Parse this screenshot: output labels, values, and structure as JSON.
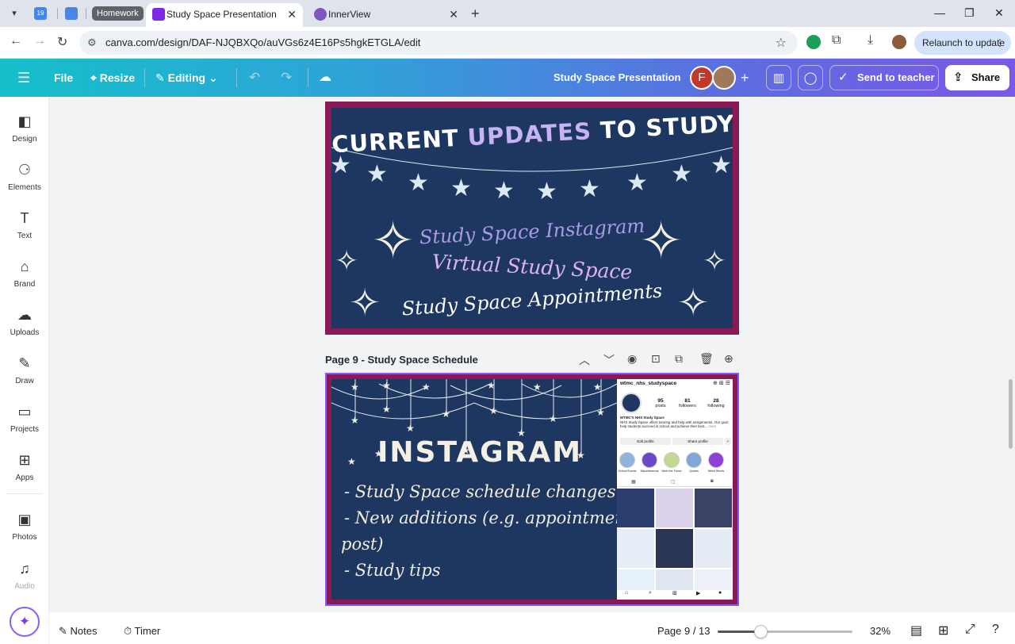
{
  "browser": {
    "tabs": [
      {
        "label": "Homework",
        "kind": "group"
      },
      {
        "label": "Study Space Presentation - Pres",
        "active": true
      },
      {
        "label": "InnerView",
        "active": false
      }
    ],
    "calendar_badge": "19",
    "url": "canva.com/design/DAF-NJQBXQo/auVGs6z4E16Ps5hgkETGLA/edit",
    "relaunch_label": "Relaunch to update"
  },
  "canva_header": {
    "file_label": "File",
    "resize_label": "Resize",
    "editing_label": "Editing",
    "presentation_name": "Study Space Presentation",
    "avatar_initial": "F",
    "send_label": "Send to teacher",
    "share_label": "Share"
  },
  "sidebar": {
    "items": [
      {
        "label": "Design",
        "icon": "design-icon",
        "glyph": "◧"
      },
      {
        "label": "Elements",
        "icon": "elements-icon",
        "glyph": "⚆"
      },
      {
        "label": "Text",
        "icon": "text-icon",
        "glyph": "T"
      },
      {
        "label": "Brand",
        "icon": "brand-icon",
        "glyph": "⌂"
      },
      {
        "label": "Uploads",
        "icon": "uploads-icon",
        "glyph": "☁"
      },
      {
        "label": "Draw",
        "icon": "draw-icon",
        "glyph": "✎"
      },
      {
        "label": "Projects",
        "icon": "projects-icon",
        "glyph": "▭"
      },
      {
        "label": "Apps",
        "icon": "apps-icon",
        "glyph": "⊞"
      },
      {
        "label": "Photos",
        "icon": "photos-icon",
        "glyph": "▣"
      },
      {
        "label": "Audio",
        "icon": "audio-icon",
        "glyph": "♫"
      }
    ]
  },
  "slide8": {
    "title_a": "CURRENT ",
    "title_b": "UPDATES",
    "title_c": " TO STUDY SPACE",
    "line1": "Study Space Instagram",
    "line2": "Virtual Study Space",
    "line3": "Study Space Appointments"
  },
  "page9": {
    "page_title": "Page 9 - Study Space Schedule",
    "heading": "INSTAGRAM",
    "bullets": [
      "-  Study Space schedule changes",
      "-  New additions (e.g. appointments",
      "post)",
      "-  Study tips"
    ]
  },
  "instagram": {
    "username": "wtmc_nhs_studyspace",
    "stats": [
      {
        "value": "95",
        "label": "posts"
      },
      {
        "value": "81",
        "label": "followers"
      },
      {
        "value": "28",
        "label": "following"
      }
    ],
    "bio_name": "WTMC'S NHS Study Space",
    "bio_text": "NHS Study Space offers tutoring and help with assignments. Our goal: help students succeed in school and achieve their best...",
    "bio_more": "more",
    "edit_profile": "Edit profile",
    "share_profile": "Share profile",
    "highlights": [
      "School Events",
      "Miscellaneous",
      "Meet the Tutors",
      "Quotes",
      "Wield Words"
    ]
  },
  "bottom": {
    "notes_label": "Notes",
    "timer_label": "Timer",
    "page_indicator": "Page 9 / 13",
    "zoom_label": "32%",
    "zoom_level": 0.32
  },
  "colors": {
    "slide_bg": "#1d3761",
    "slide_border": "#8a1955",
    "accent_purple": "#c7b2f5",
    "canva_gradient_start": "#15bfca",
    "canva_gradient_end": "#7b58e6"
  }
}
